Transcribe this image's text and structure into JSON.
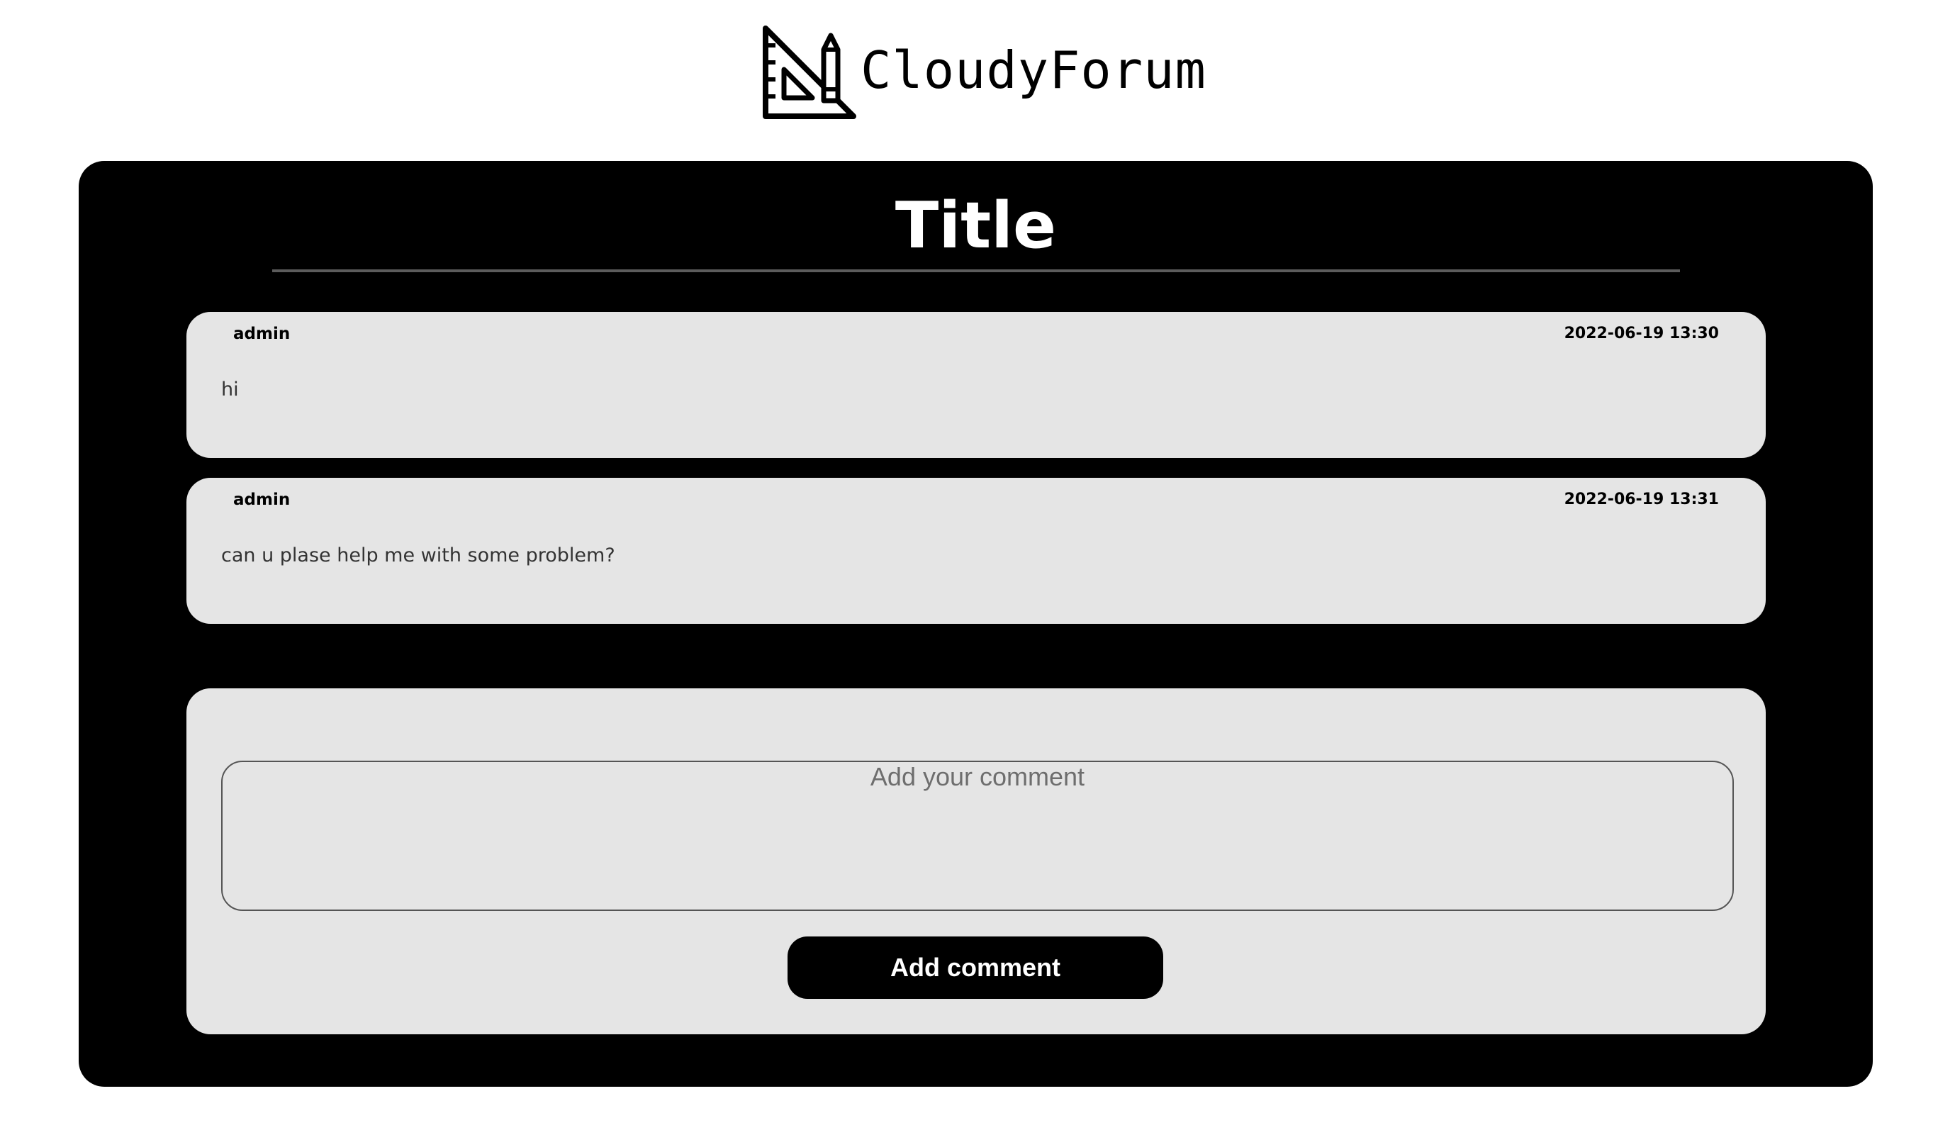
{
  "header": {
    "brand_name": "CloudyForum",
    "logo_icon": "ruler-pencil-icon"
  },
  "thread": {
    "title": "Title",
    "comments": [
      {
        "author": "admin",
        "timestamp": "2022-06-19 13:30",
        "body": "hi"
      },
      {
        "author": "admin",
        "timestamp": "2022-06-19 13:31",
        "body": "can u plase help me with some problem?"
      }
    ]
  },
  "comment_form": {
    "input_value": "",
    "input_placeholder": "Add your comment",
    "submit_label": "Add comment"
  },
  "colors": {
    "panel_background": "#000000",
    "card_background": "#e5e5e5",
    "button_background": "#000000",
    "button_text": "#ffffff"
  }
}
